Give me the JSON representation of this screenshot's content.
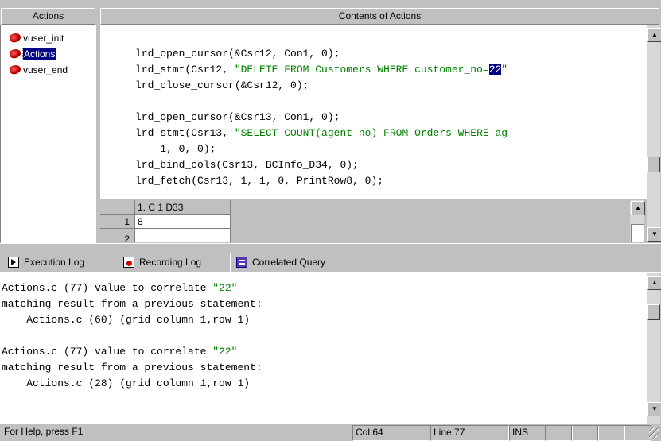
{
  "tree": {
    "header": "Actions",
    "items": [
      {
        "label": "vuser_init",
        "selected": false
      },
      {
        "label": "Actions",
        "selected": true
      },
      {
        "label": "vuser_end",
        "selected": false
      }
    ]
  },
  "editor": {
    "header": "Contents of Actions",
    "lines": [
      {
        "segments": [
          {
            "text": "lrd_open_cursor(&Csr12, Con1, 0);"
          }
        ]
      },
      {
        "segments": [
          {
            "text": "lrd_stmt(Csr12, "
          },
          {
            "text": "\"DELETE FROM Customers WHERE customer_no=",
            "style": "str"
          },
          {
            "text": "22",
            "style": "hl"
          },
          {
            "text": "\"",
            "style": "str"
          }
        ]
      },
      {
        "segments": [
          {
            "text": "lrd_close_cursor(&Csr12, 0);"
          }
        ]
      },
      {
        "segments": [
          {
            "text": ""
          }
        ]
      },
      {
        "segments": [
          {
            "text": "lrd_open_cursor(&Csr13, Con1, 0);"
          }
        ]
      },
      {
        "segments": [
          {
            "text": "lrd_stmt(Csr13, "
          },
          {
            "text": "\"SELECT COUNT(agent_no) FROM Orders WHERE ag",
            "style": "str"
          }
        ]
      },
      {
        "segments": [
          {
            "text": "    1, 0, 0);"
          }
        ]
      },
      {
        "segments": [
          {
            "text": "lrd_bind_cols(Csr13, BCInfo_D34, 0);"
          }
        ]
      },
      {
        "segments": [
          {
            "text": "lrd_fetch(Csr13, 1, 1, 0, PrintRow8, 0);"
          }
        ]
      }
    ]
  },
  "grid": {
    "column_header": "1. C 1 D33",
    "rows": [
      {
        "num": "1",
        "value": "8"
      },
      {
        "num": "2",
        "value": ""
      }
    ]
  },
  "tabs": [
    {
      "label": "Execution Log",
      "icon": "execution-log-icon"
    },
    {
      "label": "Recording Log",
      "icon": "recording-log-icon"
    },
    {
      "label": "Correlated Query",
      "icon": "correlated-query-icon",
      "active": true
    }
  ],
  "output": {
    "lines": [
      {
        "segments": [
          {
            "text": "Actions.c (77) value to correlate "
          },
          {
            "text": "\"22\"",
            "style": "str"
          }
        ]
      },
      {
        "segments": [
          {
            "text": "matching result from a previous statement:"
          }
        ]
      },
      {
        "segments": [
          {
            "text": "    Actions.c (60) (grid column 1,row 1)"
          }
        ]
      },
      {
        "segments": [
          {
            "text": ""
          }
        ]
      },
      {
        "segments": [
          {
            "text": "Actions.c (77) value to correlate "
          },
          {
            "text": "\"22\"",
            "style": "str"
          }
        ]
      },
      {
        "segments": [
          {
            "text": "matching result from a previous statement:"
          }
        ]
      },
      {
        "segments": [
          {
            "text": "    Actions.c (28) (grid column 1,row 1)"
          }
        ]
      }
    ]
  },
  "status": {
    "help": "For Help, press F1",
    "col": "Col:64",
    "line": "Line:77",
    "mode": "INS"
  },
  "colors": {
    "string": "#008000",
    "selection": "#000080",
    "chrome": "#c0c0c0"
  }
}
